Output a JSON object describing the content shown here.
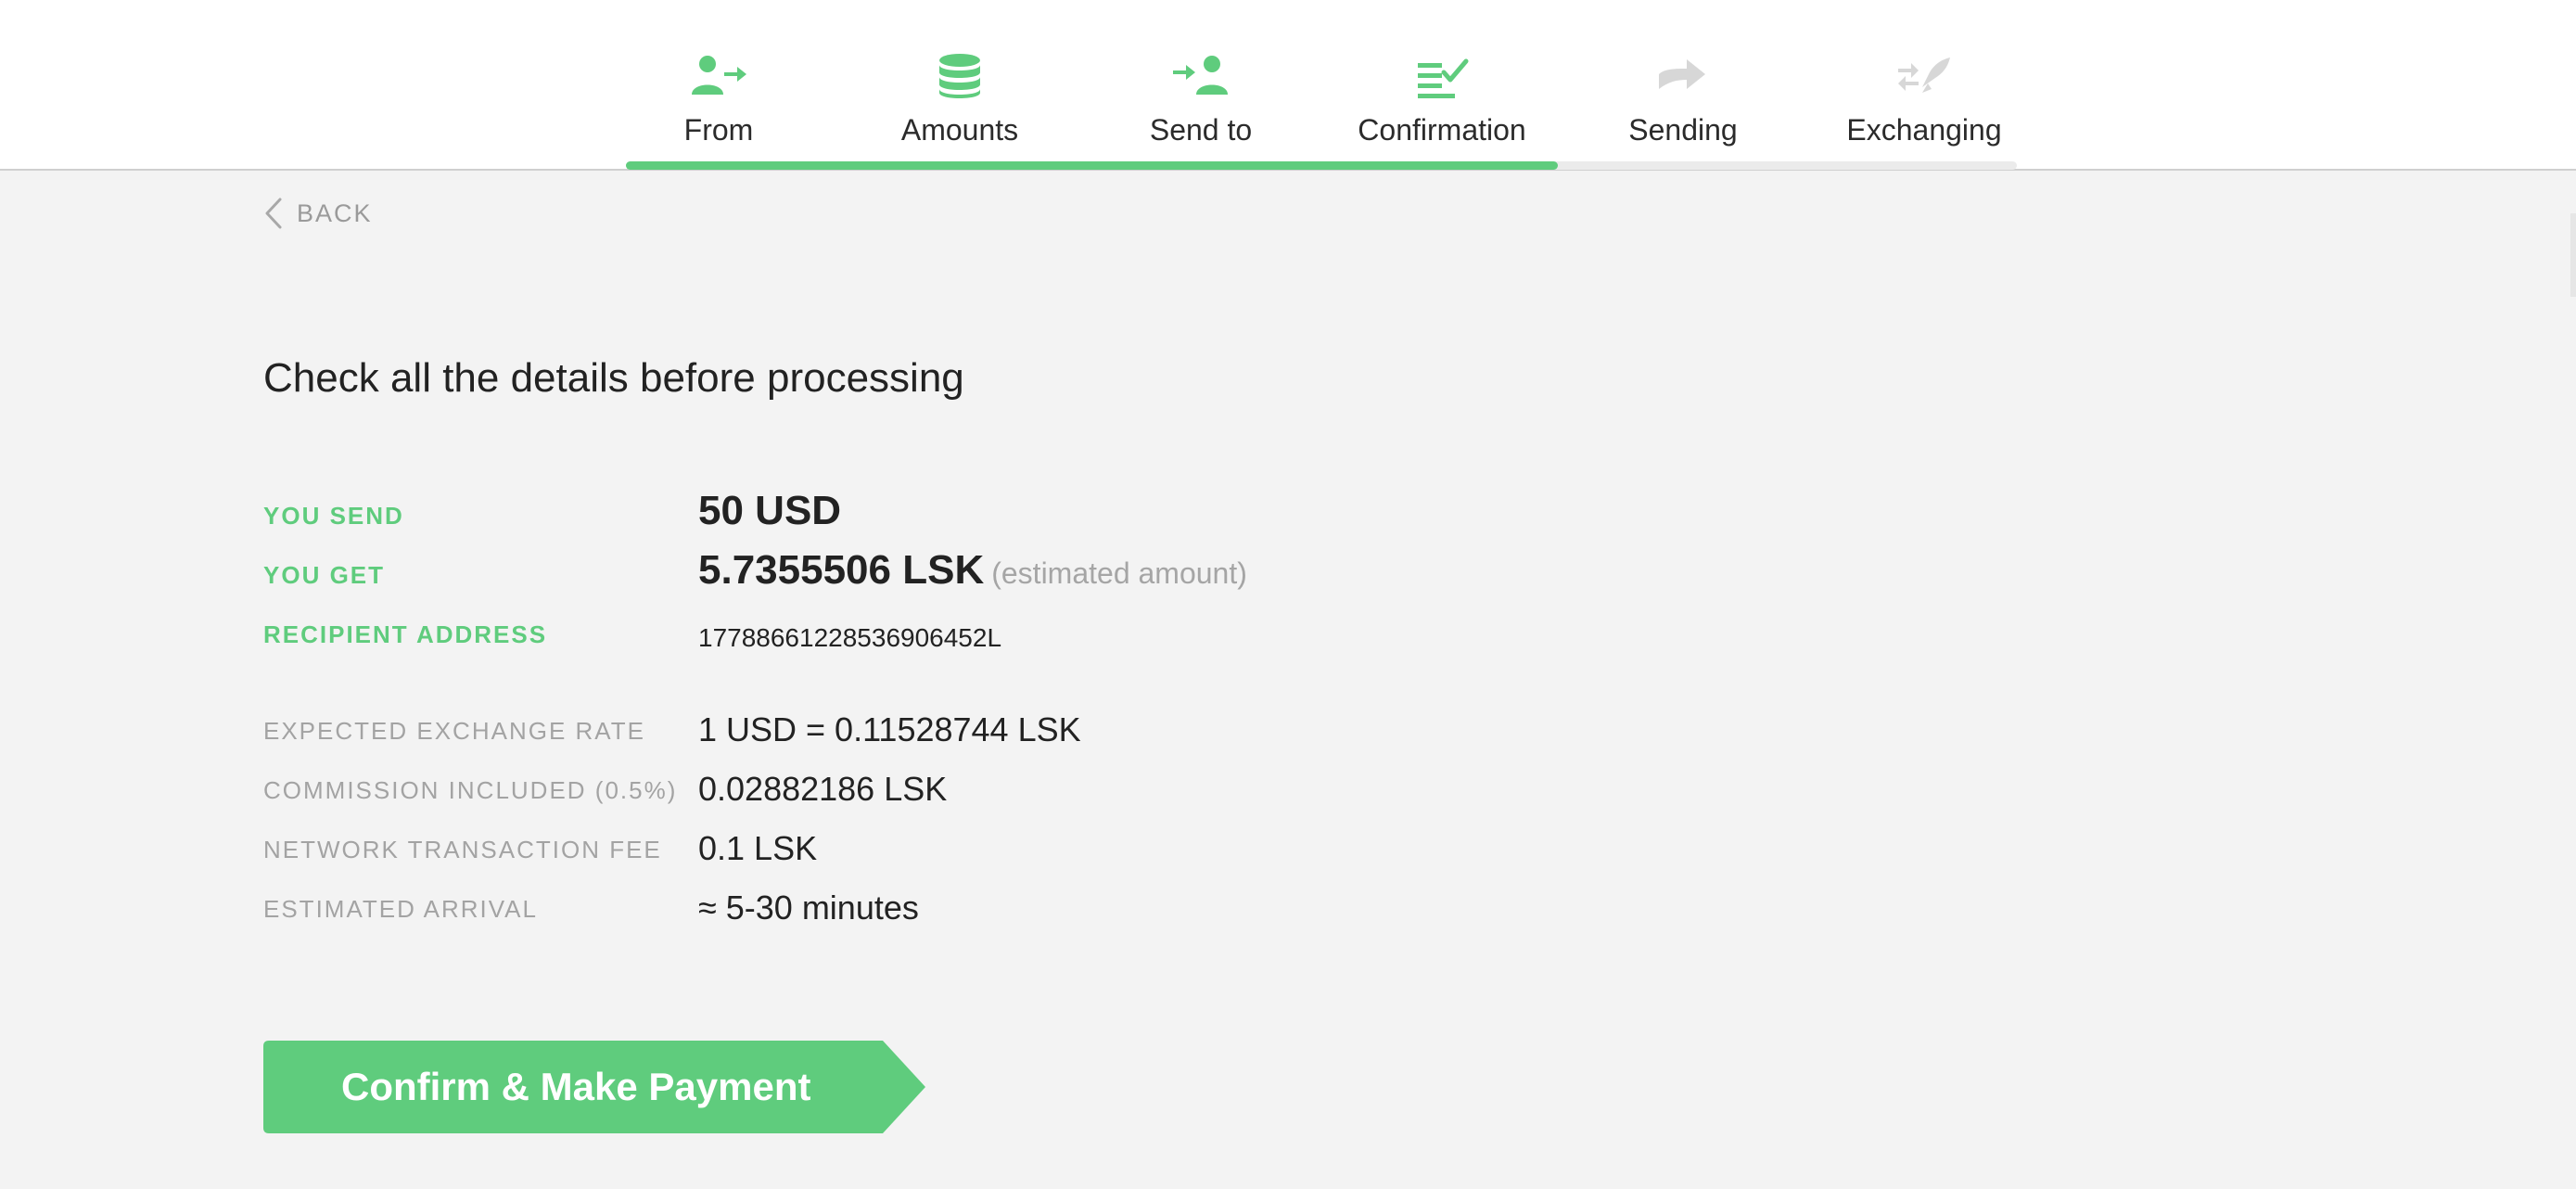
{
  "colors": {
    "accent": "#5fcc7d",
    "inactive_icon": "#d7d7d7",
    "muted_text": "#a3a3a3",
    "background": "#f3f3f3"
  },
  "stepper": {
    "progress": 0.67,
    "steps": [
      {
        "label": "From",
        "icon": "user-send-icon",
        "state": "done"
      },
      {
        "label": "Amounts",
        "icon": "coin-stack-icon",
        "state": "done"
      },
      {
        "label": "Send to",
        "icon": "user-receive-icon",
        "state": "done"
      },
      {
        "label": "Confirmation",
        "icon": "checklist-icon",
        "state": "current"
      },
      {
        "label": "Sending",
        "icon": "arrow-right-icon",
        "state": "pending"
      },
      {
        "label": "Exchanging",
        "icon": "exchange-rocket-icon",
        "state": "pending"
      }
    ]
  },
  "back": {
    "label": "BACK",
    "icon": "chevron-left-icon"
  },
  "page_title": "Check all the details before processing",
  "details": {
    "you_send": {
      "label": "YOU SEND",
      "value": "50 USD"
    },
    "you_get": {
      "label": "YOU GET",
      "value": "5.7355506 LSK",
      "note": "(estimated amount)"
    },
    "recipient": {
      "label": "RECIPIENT ADDRESS",
      "value": "17788661228536906452L"
    },
    "rate": {
      "label": "EXPECTED EXCHANGE RATE",
      "value": "1 USD = 0.11528744 LSK"
    },
    "commission": {
      "label": "COMMISSION INCLUDED (0.5%)",
      "value": "0.02882186 LSK"
    },
    "network_fee": {
      "label": "NETWORK TRANSACTION FEE",
      "value": "0.1 LSK"
    },
    "arrival": {
      "label": "ESTIMATED ARRIVAL",
      "value": "≈ 5-30 minutes"
    }
  },
  "confirm_button": {
    "label": "Confirm & Make Payment"
  }
}
